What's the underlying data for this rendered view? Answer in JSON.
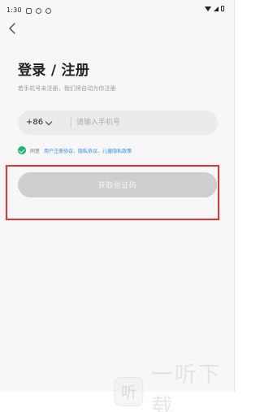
{
  "status_bar": {
    "time": "1:30",
    "left_icons": [
      "notification-icon",
      "notification-icon",
      "notification-icon"
    ],
    "right_icons": [
      "wifi-icon",
      "signal-icon",
      "battery-icon"
    ]
  },
  "header": {
    "back_icon": "chevron-left-icon"
  },
  "login": {
    "title": "登录 / 注册",
    "subtitle": "若手机号未注册，我们将自动为你注册",
    "country_code": "+86",
    "phone_placeholder": "请输入手机号",
    "phone_value": "",
    "agreement": {
      "checked": true,
      "prefix": "同意",
      "links": [
        "用户注册协议",
        "隐私协议",
        "儿童隐私政策"
      ],
      "separator": "、"
    },
    "verification_button_label": "获取验证码"
  },
  "colors": {
    "checkbox": "#16b66c",
    "link": "#2f8ce8",
    "highlight_border": "#e63434",
    "disabled_button": "#cecece"
  },
  "watermark": {
    "brand": "一听下载",
    "logo_text": "听"
  }
}
